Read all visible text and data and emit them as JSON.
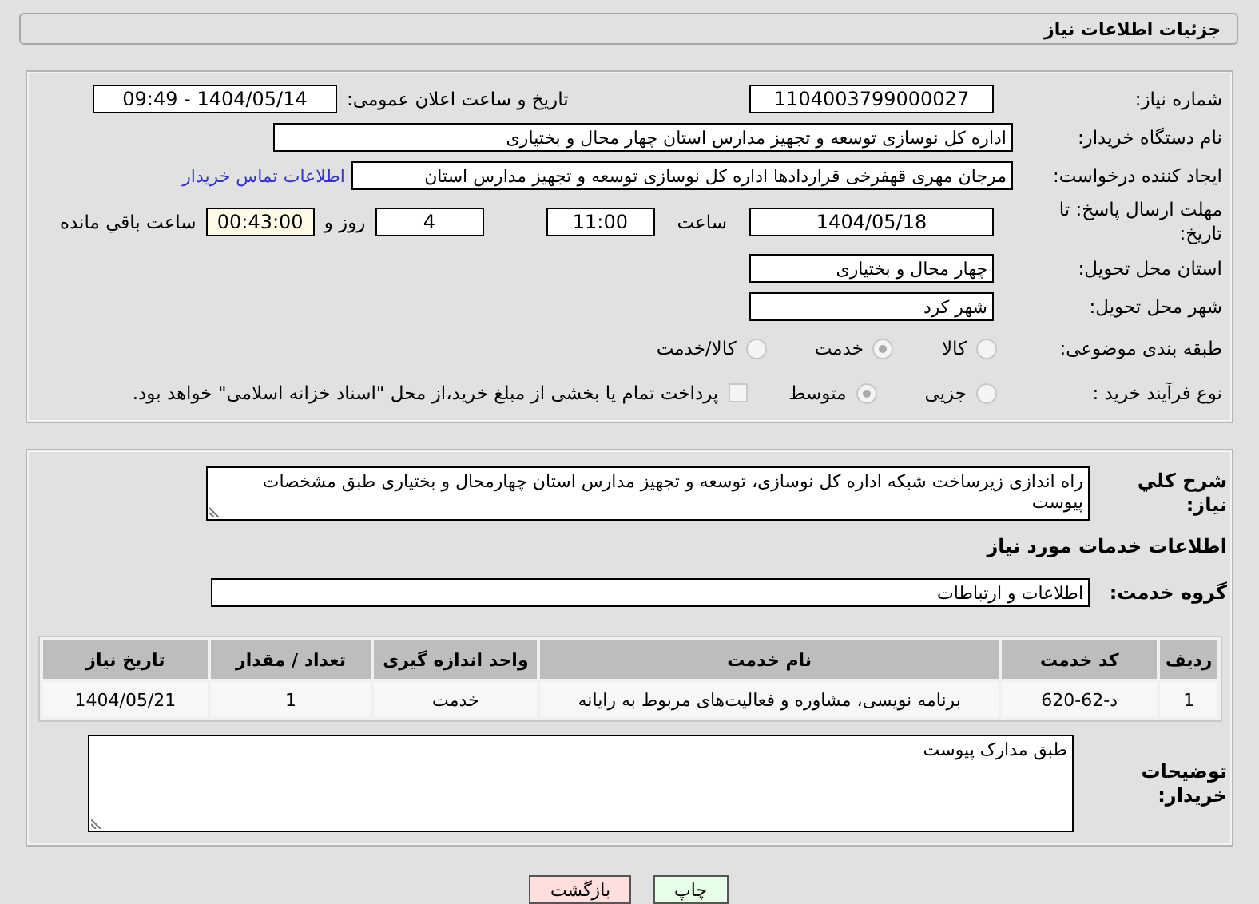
{
  "header": {
    "title": "جزئیات اطلاعات نیاز"
  },
  "need_number": {
    "label": "شماره نیاز:",
    "value": "1104003799000027"
  },
  "announce": {
    "label": "تاریخ و ساعت اعلان عمومی:",
    "value": "1404/05/14 - 09:49"
  },
  "buyer_org": {
    "label": "نام دستگاه خریدار:",
    "value": "اداره کل نوسازی  توسعه و تجهیز مدارس استان چهار محال و بختیاری"
  },
  "requester": {
    "label": "ایجاد کننده درخواست:",
    "value": "مرجان مهری قهفرخی قراردادها اداره کل نوسازی  توسعه و تجهیز مدارس استان",
    "link": "اطلاعات تماس خریدار"
  },
  "deadline": {
    "label": "مهلت ارسال پاسخ: تا تاریخ:",
    "date": "1404/05/18",
    "time_label": "ساعت",
    "time": "11:00",
    "days": "4",
    "days_label": "روز و",
    "remaining": "00:43:00",
    "remaining_label": "ساعت باقي مانده"
  },
  "province": {
    "label": "استان محل تحویل:",
    "value": "چهار محال و بختیاری"
  },
  "city": {
    "label": "شهر محل تحویل:",
    "value": "شهر کرد"
  },
  "category": {
    "label": "طبقه بندی موضوعی:",
    "options": [
      {
        "label": "کالا",
        "selected": false
      },
      {
        "label": "خدمت",
        "selected": true
      },
      {
        "label": "کالا/خدمت",
        "selected": false
      }
    ]
  },
  "purchase_type": {
    "label": "نوع فرآیند خرید :",
    "options": [
      {
        "label": "جزیی",
        "selected": false
      },
      {
        "label": "متوسط",
        "selected": true
      }
    ],
    "treasury": {
      "checked": false,
      "text": "پرداخت تمام یا بخشی از مبلغ خرید،از محل \"اسناد خزانه اسلامی\" خواهد بود."
    }
  },
  "description": {
    "label": "شرح کلي نياز:",
    "value": "راه اندازی زیرساخت شبکه اداره کل نوسازی، توسعه و تجهیز مدارس استان چهارمحال و بختیاری طبق مشخصات پیوست"
  },
  "services_heading": "اطلاعات خدمات مورد نیاز",
  "service_group": {
    "label": "گروه خدمت:",
    "value": "اطلاعات و ارتباطات"
  },
  "table": {
    "columns": [
      "ردیف",
      "کد خدمت",
      "نام خدمت",
      "واحد اندازه گیری",
      "تعداد / مقدار",
      "تاریخ نیاز"
    ],
    "rows": [
      [
        "1",
        "د-62-620",
        "برنامه نویسی، مشاوره و فعالیت‌های مربوط به رایانه",
        "خدمت",
        "1",
        "1404/05/21"
      ]
    ]
  },
  "buyer_notes": {
    "label": "توضیحات خریدار:",
    "value": "طبق مدارک پیوست"
  },
  "buttons": [
    {
      "kind": "print",
      "label": "چاپ"
    },
    {
      "kind": "back",
      "label": "بازگشت"
    }
  ]
}
